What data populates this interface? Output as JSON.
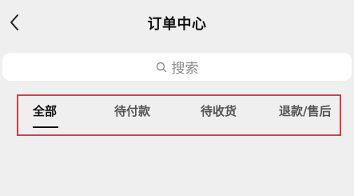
{
  "header": {
    "title": "订单中心",
    "back_icon": "chevron-left-icon"
  },
  "search": {
    "placeholder": "搜索",
    "icon": "search-icon"
  },
  "tabs": [
    {
      "label": "全部",
      "active": true
    },
    {
      "label": "待付款",
      "active": false
    },
    {
      "label": "待收货",
      "active": false
    },
    {
      "label": "退款/售后",
      "active": false
    }
  ],
  "colors": {
    "background": "#efefef",
    "highlight_border": "#e23b3b",
    "active_tab": "#111111",
    "inactive_tab": "#555555"
  }
}
